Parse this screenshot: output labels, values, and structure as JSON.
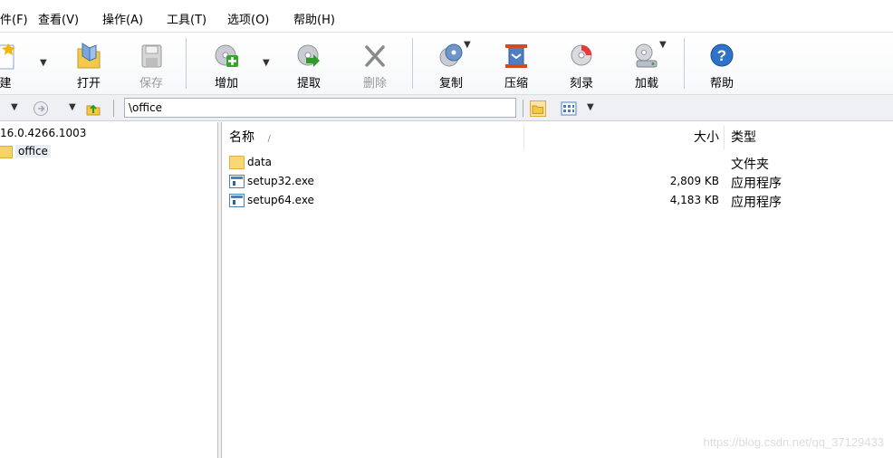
{
  "menu": [
    "件(F)",
    "查看(V)",
    "操作(A)",
    "工具(T)",
    "选项(O)",
    "帮助(H)"
  ],
  "toolbar": {
    "new_label": "建",
    "open_label": "打开",
    "save_label": "保存",
    "add_label": "增加",
    "extract_label": "提取",
    "delete_label": "删除",
    "copy_label": "复制",
    "compress_label": "压缩",
    "burn_label": "刻录",
    "mount_label": "加载",
    "help_label": "帮助"
  },
  "address": {
    "path": "\\office"
  },
  "tree": {
    "root_label": "16.0.4266.1003",
    "selected_folder": "office"
  },
  "list": {
    "columns": {
      "name": "名称",
      "sort_indicator": "/",
      "size": "大小",
      "type": "类型"
    },
    "rows": [
      {
        "name": "data",
        "size": "",
        "type": "文件夹",
        "icon": "folder-icon"
      },
      {
        "name": "setup32.exe",
        "size": "2,809 KB",
        "type": "应用程序",
        "icon": "exe-icon"
      },
      {
        "name": "setup64.exe",
        "size": "4,183 KB",
        "type": "应用程序",
        "icon": "exe-icon"
      }
    ]
  },
  "watermark": "https://blog.csdn.net/qq_37129433"
}
